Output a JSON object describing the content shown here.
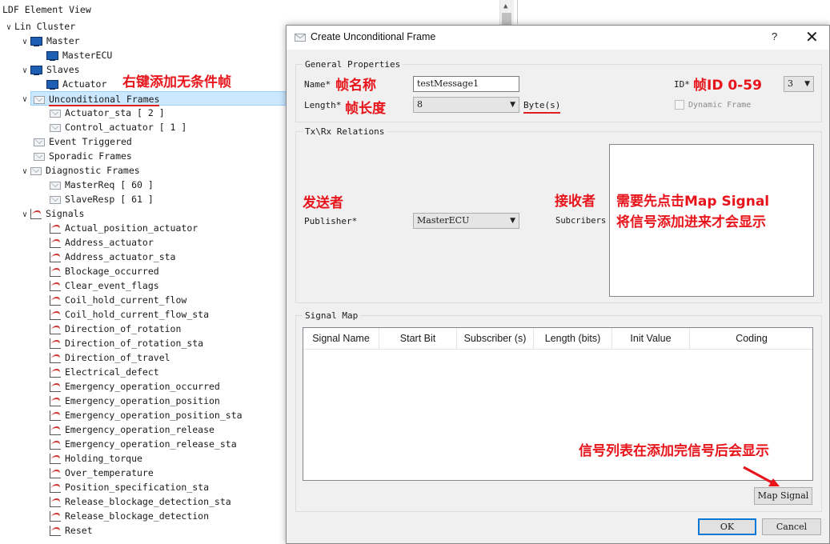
{
  "tree": {
    "header": "LDF Element View",
    "rows": [
      {
        "label": "Lin Cluster"
      },
      {
        "label": "Master"
      },
      {
        "label": "MasterECU"
      },
      {
        "label": "Slaves"
      },
      {
        "label": "Actuator"
      },
      {
        "label": "Unconditional Frames"
      },
      {
        "label": "Actuator_sta [ 2 ]"
      },
      {
        "label": "Control_actuator [ 1 ]"
      },
      {
        "label": "Event Triggered"
      },
      {
        "label": "Sporadic Frames"
      },
      {
        "label": "Diagnostic Frames"
      },
      {
        "label": "MasterReq [ 60 ]"
      },
      {
        "label": "SlaveResp [ 61 ]"
      },
      {
        "label": "Signals"
      }
    ],
    "signals": [
      "Actual_position_actuator",
      "Address_actuator",
      "Address_actuator_sta",
      "Blockage_occurred",
      "Clear_event_flags",
      "Coil_hold_current_flow",
      "Coil_hold_current_flow_sta",
      "Direction_of_rotation",
      "Direction_of_rotation_sta",
      "Direction_of_travel",
      "Electrical_defect",
      "Emergency_operation_occurred",
      "Emergency_operation_position",
      "Emergency_operation_position_sta",
      "Emergency_operation_release",
      "Emergency_operation_release_sta",
      "Holding_torque",
      "Over_temperature",
      "Position_specification_sta",
      "Release_blockage_detection_sta",
      "Release_blockage_detection",
      "Reset"
    ]
  },
  "annotations": {
    "right_click": "右键添加无条件帧",
    "frame_name": "帧名称",
    "frame_length": "帧长度",
    "frame_id": "帧ID 0-59",
    "publisher": "发送者",
    "receiver": "接收者",
    "map_note_1": "需要先点击Map Signal",
    "map_note_2": "将信号添加进来才会显示",
    "table_note": "信号列表在添加完信号后会显示"
  },
  "dialog": {
    "title": "Create Unconditional Frame",
    "help": "?",
    "close": "✕",
    "general": {
      "legend": "General Properties",
      "name_label": "Name*",
      "name_value": "testMessage1",
      "length_label": "Length*",
      "length_value": "8",
      "length_unit": "Byte(s)",
      "id_label": "ID*",
      "id_value": "3",
      "dynamic_label": "Dynamic Frame"
    },
    "txrx": {
      "legend": "Tx\\Rx Relations",
      "publisher_label": "Publisher*",
      "publisher_value": "MasterECU",
      "subscribers_label": "Subcribers"
    },
    "signal_map": {
      "legend": "Signal Map",
      "columns": [
        "Signal Name",
        "Start Bit",
        "Subscriber (s)",
        "Length (bits)",
        "Init Value",
        "Coding"
      ],
      "map_button": "Map Signal"
    },
    "ok": "OK",
    "cancel": "Cancel"
  },
  "colors": {
    "annotation_red": "#e8141b",
    "selection": "#cce8ff",
    "default_button_border": "#0078d7"
  }
}
